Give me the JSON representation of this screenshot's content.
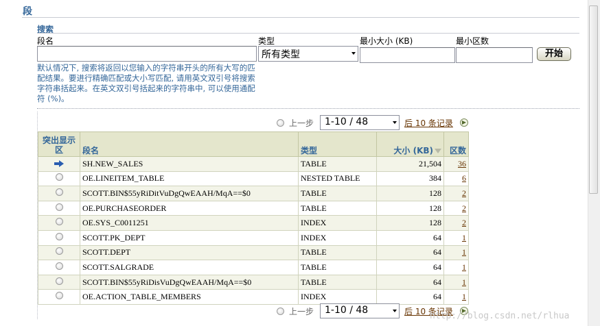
{
  "page": {
    "title": "段"
  },
  "search": {
    "heading": "搜索",
    "name_label": "段名",
    "type_label": "类型",
    "type_selected": "所有类型",
    "min_size_label": "最小大小 (KB)",
    "min_extents_label": "最小区数",
    "go_label": "开始",
    "hint": "默认情况下, 搜索将返回以您输入的字符串开头的所有大写的匹配结果。要进行精确匹配或大小写匹配, 请用英文双引号将搜索字符串括起来。在英文双引号括起来的字符串中, 可以使用通配符 (%)。"
  },
  "pager": {
    "prev_label": "上一步",
    "range": "1-10 / 48",
    "next_label": "后 10 条记录"
  },
  "table": {
    "headers": {
      "select": "突出显示区",
      "name": "段名",
      "type": "类型",
      "size": "大小 (KB)",
      "extents": "区数"
    },
    "rows": [
      {
        "name": "SH.NEW_SALES",
        "type": "TABLE",
        "size": "21,504",
        "extents": "36",
        "selected": true
      },
      {
        "name": "OE.LINEITEM_TABLE",
        "type": "NESTED TABLE",
        "size": "384",
        "extents": "6"
      },
      {
        "name": "SCOTT.BIN$55yRiDitVuDgQwEAAH/MqA==$0",
        "type": "TABLE",
        "size": "128",
        "extents": "2"
      },
      {
        "name": "OE.PURCHASEORDER",
        "type": "TABLE",
        "size": "128",
        "extents": "2"
      },
      {
        "name": "OE.SYS_C0011251",
        "type": "INDEX",
        "size": "128",
        "extents": "2"
      },
      {
        "name": "SCOTT.PK_DEPT",
        "type": "INDEX",
        "size": "64",
        "extents": "1"
      },
      {
        "name": "SCOTT.DEPT",
        "type": "TABLE",
        "size": "64",
        "extents": "1"
      },
      {
        "name": "SCOTT.SALGRADE",
        "type": "TABLE",
        "size": "64",
        "extents": "1"
      },
      {
        "name": "SCOTT.BIN$55yRiDisVuDgQwEAAH/MqA==$0",
        "type": "TABLE",
        "size": "64",
        "extents": "1"
      },
      {
        "name": "OE.ACTION_TABLE_MEMBERS",
        "type": "INDEX",
        "size": "64",
        "extents": "1"
      }
    ]
  },
  "watermark": "http://blog.csdn.net/rlhua",
  "colors": {
    "header_blue": "#336699",
    "link_brown": "#663300",
    "table_header_bg": "#e4e6cc"
  }
}
